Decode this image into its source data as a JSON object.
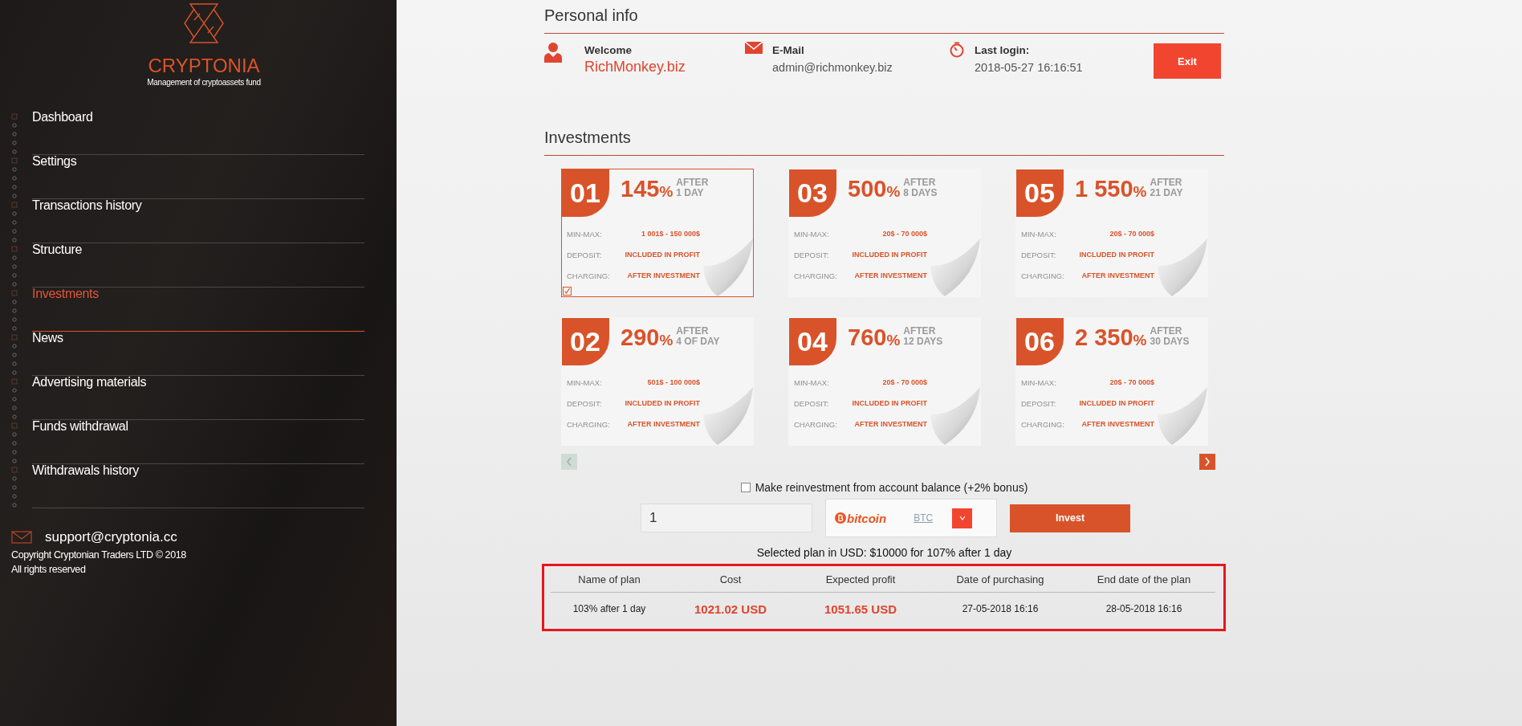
{
  "sidebar": {
    "brand": "CRYPTONIA",
    "tagline": "Management of cryptoassets fund",
    "items": [
      {
        "label": "Dashboard",
        "selected": false
      },
      {
        "label": "Settings",
        "selected": false
      },
      {
        "label": "Transactions history",
        "selected": false
      },
      {
        "label": "Structure",
        "selected": false
      },
      {
        "label": "Investments",
        "selected": true
      },
      {
        "label": "News",
        "selected": false
      },
      {
        "label": "Advertising materials",
        "selected": false
      },
      {
        "label": "Funds withdrawal",
        "selected": false
      },
      {
        "label": "Withdrawals history",
        "selected": false
      }
    ],
    "support_email": "support@cryptonia.cc",
    "copyright": "Copyright Cryptonian Traders LTD © 2018",
    "rights": "All rights reserved"
  },
  "personal_info": {
    "title": "Personal info",
    "welcome_label": "Welcome",
    "username": "RichMonkey.biz",
    "email_label": "E-Mail",
    "email": "admin@richmonkey.biz",
    "login_label": "Last login:",
    "last_login": "2018-05-27 16:16:51",
    "exit_button": "Exit"
  },
  "investments": {
    "title": "Investments",
    "plans": [
      {
        "number": "01",
        "percent": "145",
        "unit": "%",
        "after": "AFTER",
        "period": "1 DAY",
        "selected": true,
        "rows": [
          {
            "label": "MIN-MAX:",
            "value": "1 001$ - 150 000$"
          },
          {
            "label": "DEPOSIT:",
            "value": "INCLUDED IN PROFIT"
          },
          {
            "label": "CHARGING:",
            "value": "AFTER INVESTMENT"
          }
        ]
      },
      {
        "number": "03",
        "percent": "500",
        "unit": "%",
        "after": "AFTER",
        "period": "8 DAYS",
        "selected": false,
        "rows": [
          {
            "label": "MIN-MAX:",
            "value": "20$ - 70 000$"
          },
          {
            "label": "DEPOSIT:",
            "value": "INCLUDED IN PROFIT"
          },
          {
            "label": "CHARGING:",
            "value": "AFTER INVESTMENT"
          }
        ]
      },
      {
        "number": "05",
        "percent": "1 550",
        "unit": "%",
        "after": "AFTER",
        "period": "21 DAY",
        "selected": false,
        "rows": [
          {
            "label": "MIN-MAX:",
            "value": "20$ - 70 000$"
          },
          {
            "label": "DEPOSIT:",
            "value": "INCLUDED IN PROFIT"
          },
          {
            "label": "CHARGING:",
            "value": "AFTER INVESTMENT"
          }
        ]
      },
      {
        "number": "02",
        "percent": "290",
        "unit": "%",
        "after": "AFTER",
        "period": "4 OF DAY",
        "selected": false,
        "rows": [
          {
            "label": "MIN-MAX:",
            "value": "501$ - 100 000$"
          },
          {
            "label": "DEPOSIT:",
            "value": "INCLUDED IN PROFIT"
          },
          {
            "label": "CHARGING:",
            "value": "AFTER INVESTMENT"
          }
        ]
      },
      {
        "number": "04",
        "percent": "760",
        "unit": "%",
        "after": "AFTER",
        "period": "12 DAYS",
        "selected": false,
        "rows": [
          {
            "label": "MIN-MAX:",
            "value": "20$ - 70 000$"
          },
          {
            "label": "DEPOSIT:",
            "value": "INCLUDED IN PROFIT"
          },
          {
            "label": "CHARGING:",
            "value": "AFTER INVESTMENT"
          }
        ]
      },
      {
        "number": "06",
        "percent": "2 350",
        "unit": "%",
        "after": "AFTER",
        "period": "30 DAYS",
        "selected": false,
        "rows": [
          {
            "label": "MIN-MAX:",
            "value": "20$ - 70 000$"
          },
          {
            "label": "DEPOSIT:",
            "value": "INCLUDED IN PROFIT"
          },
          {
            "label": "CHARGING:",
            "value": "AFTER INVESTMENT"
          }
        ]
      }
    ],
    "prev_disabled": true,
    "next_disabled": false,
    "reinvest": {
      "label": "Make reinvestment from account balance (+2% bonus)",
      "checked": false
    },
    "amount": "1",
    "currency_logo": "bitcoin",
    "currency_code": "BTC",
    "invest_button": "Invest",
    "selected_plan": "Selected plan in USD: $10000 for 107% after 1 day"
  },
  "table": {
    "columns": [
      "Name of plan",
      "Cost",
      "Expected profit",
      "Date of purchasing",
      "End date of the plan"
    ],
    "rows": [
      [
        "103% after 1 day",
        "1021.02 USD",
        "1051.65 USD",
        "27-05-2018 16:16",
        "28-05-2018 16:16"
      ]
    ]
  }
}
